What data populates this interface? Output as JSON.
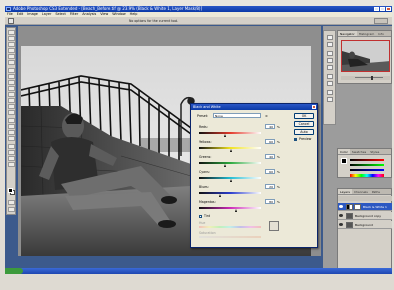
{
  "window": {
    "title": "Adobe Photoshop CS3 Extended - [Beach_Before.tif @ 23.9% (Black & White 1, Layer Mask/8)]"
  },
  "menu": {
    "items": [
      "File",
      "Edit",
      "Image",
      "Layer",
      "Select",
      "Filter",
      "Analysis",
      "View",
      "Window",
      "Help"
    ]
  },
  "options_bar": {
    "tip": "No options for the current tool."
  },
  "panels": {
    "navigator_tabs": [
      "Navigator",
      "Histogram",
      "Info"
    ],
    "color_tabs": [
      "Color",
      "Swatches",
      "Styles"
    ],
    "layers_tabs": [
      "Layers",
      "Channels",
      "Paths"
    ],
    "layers": [
      {
        "name": "Black & White 1",
        "selected": true
      },
      {
        "name": "Background copy",
        "selected": false
      },
      {
        "name": "Background",
        "selected": false
      }
    ]
  },
  "dialog": {
    "title": "Black and White",
    "preset_label": "Preset:",
    "preset_value": "None",
    "ok_label": "OK",
    "cancel_label": "Cancel",
    "auto_label": "Auto",
    "preview_label": "Preview",
    "tint_label": "Tint",
    "hue_label": "Hue",
    "saturation_label": "Saturation",
    "sliders": [
      {
        "label": "Reds:",
        "value": "40",
        "unit": "%",
        "color": "#e23a2a",
        "position": 0.43
      },
      {
        "label": "Yellows:",
        "value": "60",
        "unit": "%",
        "color": "#f0e21e",
        "position": 0.52
      },
      {
        "label": "Greens:",
        "value": "40",
        "unit": "%",
        "color": "#2aa83c",
        "position": 0.43
      },
      {
        "label": "Cyans:",
        "value": "60",
        "unit": "%",
        "color": "#22bcd2",
        "position": 0.52
      },
      {
        "label": "Blues:",
        "value": "20",
        "unit": "%",
        "color": "#2a3ccc",
        "position": 0.35
      },
      {
        "label": "Magentas:",
        "value": "80",
        "unit": "%",
        "color": "#cc2ab8",
        "position": 0.61
      }
    ]
  }
}
